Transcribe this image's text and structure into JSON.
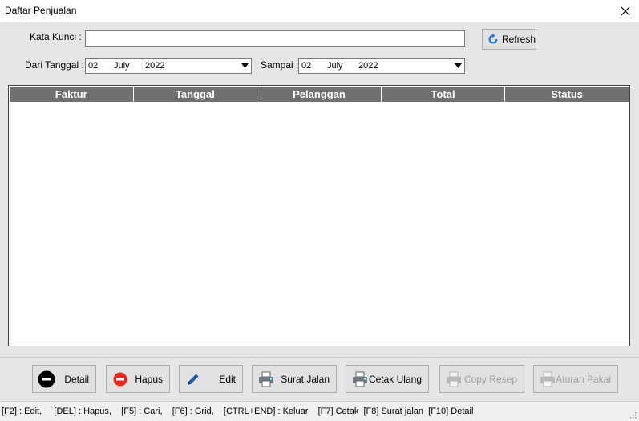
{
  "window": {
    "title": "Daftar Penjualan"
  },
  "filter": {
    "keyword_label": "Kata Kunci :",
    "keyword_value": "",
    "refresh_label": "Refresh",
    "from_label": "Dari Tanggal :",
    "from_date": {
      "day": "02",
      "month": "July",
      "year": "2022"
    },
    "to_label": "Sampai :",
    "to_date": {
      "day": "02",
      "month": "July",
      "year": "2022"
    }
  },
  "grid": {
    "columns": [
      "Faktur",
      "Tanggal",
      "Pelanggan",
      "Total",
      "Status"
    ],
    "rows": []
  },
  "toolbar": {
    "detail_label": "Detail",
    "hapus_label": "Hapus",
    "edit_label": "Edit",
    "surat_jalan_label": "Surat Jalan",
    "cetak_ulang_label": "Cetak Ulang",
    "copy_resep_label": "Copy Resep",
    "aturan_pakai_label": "Aturan Pakai"
  },
  "status_bar": {
    "shortcuts": "[F2] : Edit,     [DEL] : Hapus,    [F5] : Cari,    [F6] : Grid,    [CTRL+END] : Keluar    [F7] Cetak  [F8] Surat jalan  [F10] Detail"
  }
}
